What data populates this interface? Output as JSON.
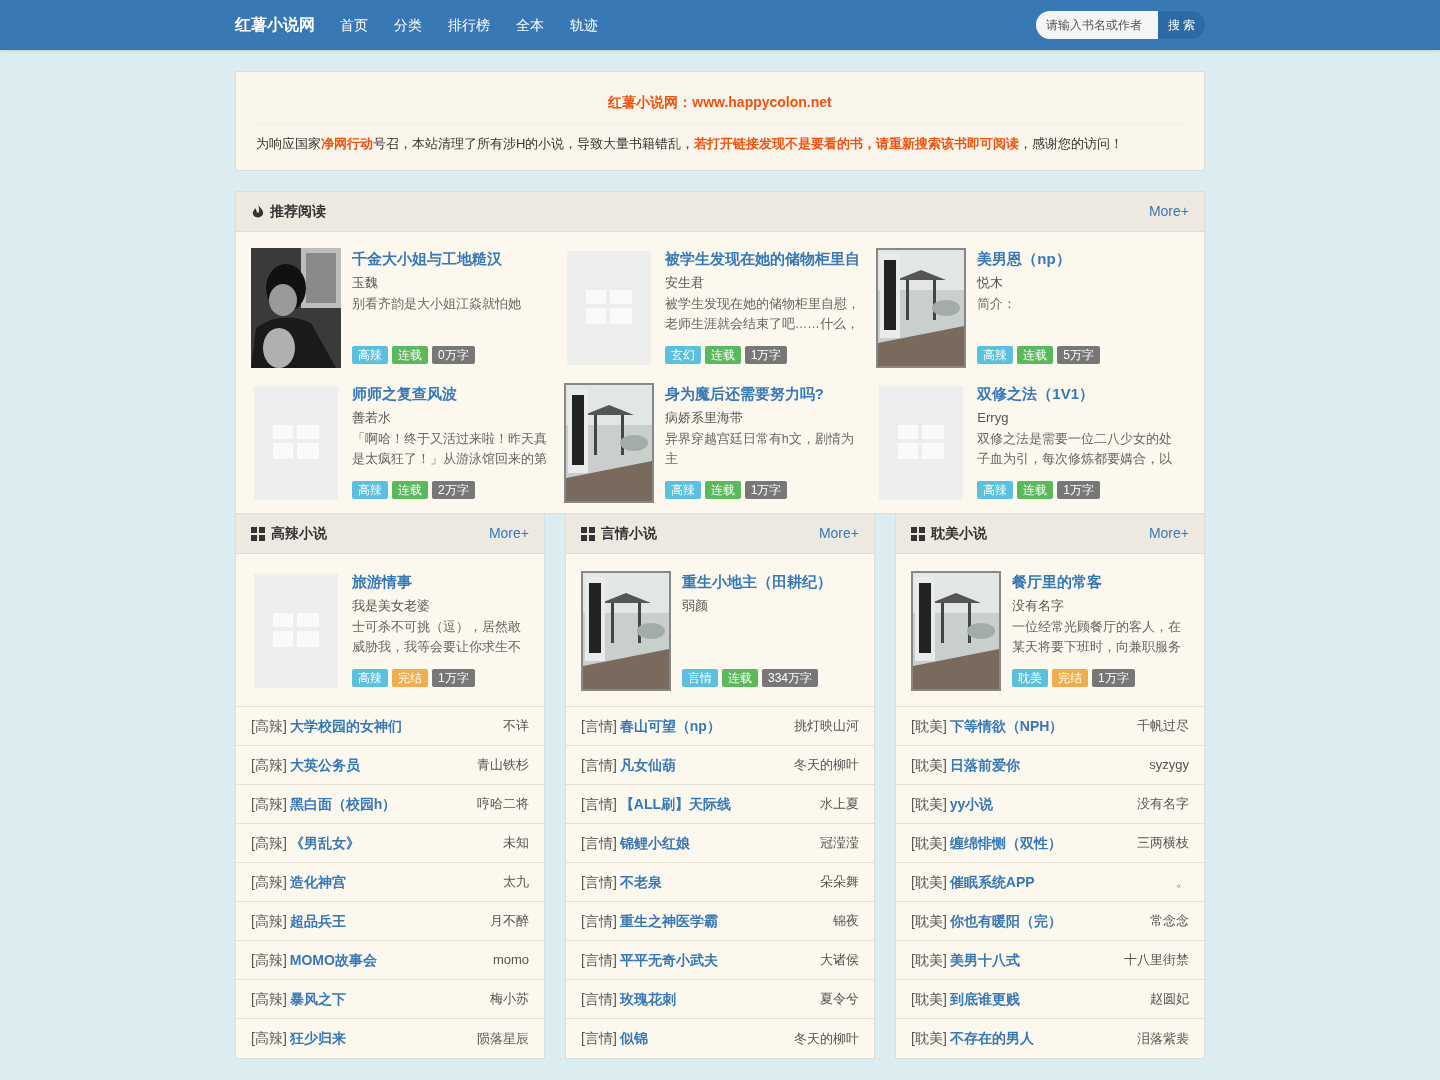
{
  "nav": {
    "brand": "红薯小说网",
    "links": [
      "首页",
      "分类",
      "排行榜",
      "全本",
      "轨迹"
    ],
    "search": {
      "placeholder": "请输入书名或作者",
      "button": "搜 索"
    }
  },
  "notice": {
    "title": "红薯小说网：www.happycolon.net",
    "text": "为响应国家**净网行动**号召，本站清理了所有涉H的小说，导致大量书籍错乱，**若打开链接发现不是要看的书，请重新搜索该书即可阅读**，感谢您的访问！"
  },
  "recommend": {
    "title": "推荐阅读",
    "more": "More+",
    "books": [
      {
        "title": "千金大小姐与工地糙汉",
        "author": "玉魏",
        "intro": "别看齐韵是大小姐江焱就怕她",
        "tags": [
          {
            "text": "高辣",
            "color": "#5bc0de"
          },
          {
            "text": "连载",
            "color": "#5cb85c"
          },
          {
            "text": "0万字",
            "color": "#777777"
          }
        ]
      },
      {
        "title": "被学生发现在她的储物柜里自",
        "author": "安生君",
        "intro": "被学生发现在她的储物柜里自慰，老师生涯就会结束了吧……什么，",
        "tags": [
          {
            "text": "玄幻",
            "color": "#5bc0de"
          },
          {
            "text": "连载",
            "color": "#5cb85c"
          },
          {
            "text": "1万字",
            "color": "#777777"
          }
        ]
      },
      {
        "title": "美男恩（np）",
        "author": "悦木",
        "intro": "简介：",
        "tags": [
          {
            "text": "高辣",
            "color": "#5bc0de"
          },
          {
            "text": "连载",
            "color": "#5cb85c"
          },
          {
            "text": "5万字",
            "color": "#777777"
          }
        ]
      },
      {
        "title": "师师之复查风波",
        "author": "善若水",
        "intro": "「啊哈！终于又活过来啦！昨天真是太疯狂了！」从游泳馆回来的第",
        "tags": [
          {
            "text": "高辣",
            "color": "#5bc0de"
          },
          {
            "text": "连载",
            "color": "#5cb85c"
          },
          {
            "text": "2万字",
            "color": "#777777"
          }
        ]
      },
      {
        "title": "身为魔后还需要努力吗?",
        "author": "病娇系里海带",
        "intro": "异界穿越宫廷日常有h文，剧情为主",
        "tags": [
          {
            "text": "高辣",
            "color": "#5bc0de"
          },
          {
            "text": "连载",
            "color": "#5cb85c"
          },
          {
            "text": "1万字",
            "color": "#777777"
          }
        ]
      },
      {
        "title": "双修之法（1V1）",
        "author": "Erryg",
        "intro": "双修之法是需要一位二八少女的处子血为引，每次修炼都要媾合，以",
        "tags": [
          {
            "text": "高辣",
            "color": "#5bc0de"
          },
          {
            "text": "连载",
            "color": "#5cb85c"
          },
          {
            "text": "1万字",
            "color": "#777777"
          }
        ]
      }
    ]
  },
  "categories": [
    {
      "title": "高辣小说",
      "more": "More+",
      "featured": {
        "title": "旅游情事",
        "author": "我是美女老婆",
        "intro": "士可杀不可挑（逗），居然敢威胁我，我等会要让你求生不",
        "tags": [
          {
            "text": "高辣",
            "color": "#5bc0de"
          },
          {
            "text": "完结",
            "color": "#f0ad4e"
          },
          {
            "text": "1万字",
            "color": "#777777"
          }
        ]
      },
      "list": [
        {
          "genre": "[高辣]",
          "title": "大学校园的女神们",
          "author": "不详"
        },
        {
          "genre": "[高辣]",
          "title": "大英公务员",
          "author": "青山铁杉"
        },
        {
          "genre": "[高辣]",
          "title": "黑白面（校园h）",
          "author": "哼哈二将"
        },
        {
          "genre": "[高辣]",
          "title": "《男乱女》",
          "author": "未知"
        },
        {
          "genre": "[高辣]",
          "title": "造化神宫",
          "author": "太九"
        },
        {
          "genre": "[高辣]",
          "title": "超品兵王",
          "author": "月不醉"
        },
        {
          "genre": "[高辣]",
          "title": "MOMO故事会",
          "author": "momo"
        },
        {
          "genre": "[高辣]",
          "title": "暴风之下",
          "author": "梅小苏"
        },
        {
          "genre": "[高辣]",
          "title": "狂少归来",
          "author": "陨落星辰"
        }
      ]
    },
    {
      "title": "言情小说",
      "more": "More+",
      "featured": {
        "title": "重生小地主（田耕纪）",
        "author": "弱颜",
        "tags": [
          {
            "text": "言情",
            "color": "#5bc0de"
          },
          {
            "text": "连载",
            "color": "#5cb85c"
          },
          {
            "text": "334万字",
            "color": "#777777"
          }
        ]
      },
      "list": [
        {
          "genre": "[言情]",
          "title": "春山可望（np）",
          "author": "挑灯映山河"
        },
        {
          "genre": "[言情]",
          "title": "凡女仙葫",
          "author": "冬天的柳叶"
        },
        {
          "genre": "[言情]",
          "title": "【ALL刷】天际线",
          "author": "水上夏"
        },
        {
          "genre": "[言情]",
          "title": "锦鲤小红娘",
          "author": "冠滢滢"
        },
        {
          "genre": "[言情]",
          "title": "不老泉",
          "author": "朵朵舞"
        },
        {
          "genre": "[言情]",
          "title": "重生之神医学霸",
          "author": "锦夜"
        },
        {
          "genre": "[言情]",
          "title": "平平无奇小武夫",
          "author": "大诸侯"
        },
        {
          "genre": "[言情]",
          "title": "玫瑰花刺",
          "author": "夏令兮"
        },
        {
          "genre": "[言情]",
          "title": "似锦",
          "author": "冬天的柳叶"
        }
      ]
    },
    {
      "title": "耽美小说",
      "more": "More+",
      "featured": {
        "title": "餐厅里的常客",
        "author": "没有名字",
        "intro": "一位经常光顾餐厅的客人，在某天将要下班时，向兼职服务",
        "tags": [
          {
            "text": "耽美",
            "color": "#5bc0de"
          },
          {
            "text": "完结",
            "color": "#f0ad4e"
          },
          {
            "text": "1万字",
            "color": "#777777"
          }
        ]
      },
      "list": [
        {
          "genre": "[耽美]",
          "title": "下等情欲（NPH）",
          "author": "千帆过尽"
        },
        {
          "genre": "[耽美]",
          "title": "日落前爱你",
          "author": "syzygy"
        },
        {
          "genre": "[耽美]",
          "title": "yy小说",
          "author": "没有名字"
        },
        {
          "genre": "[耽美]",
          "title": "缠绵悱恻（双性）",
          "author": "三两横枝"
        },
        {
          "genre": "[耽美]",
          "title": "催眠系统APP",
          "author": "。"
        },
        {
          "genre": "[耽美]",
          "title": "你也有暖阳（完）",
          "author": "常念念"
        },
        {
          "genre": "[耽美]",
          "title": "美男十八式",
          "author": "十八里街禁"
        },
        {
          "genre": "[耽美]",
          "title": "到底谁更贱",
          "author": "赵圆妃"
        },
        {
          "genre": "[耽美]",
          "title": "不存在的男人",
          "author": "泪落紫裴"
        }
      ]
    }
  ]
}
